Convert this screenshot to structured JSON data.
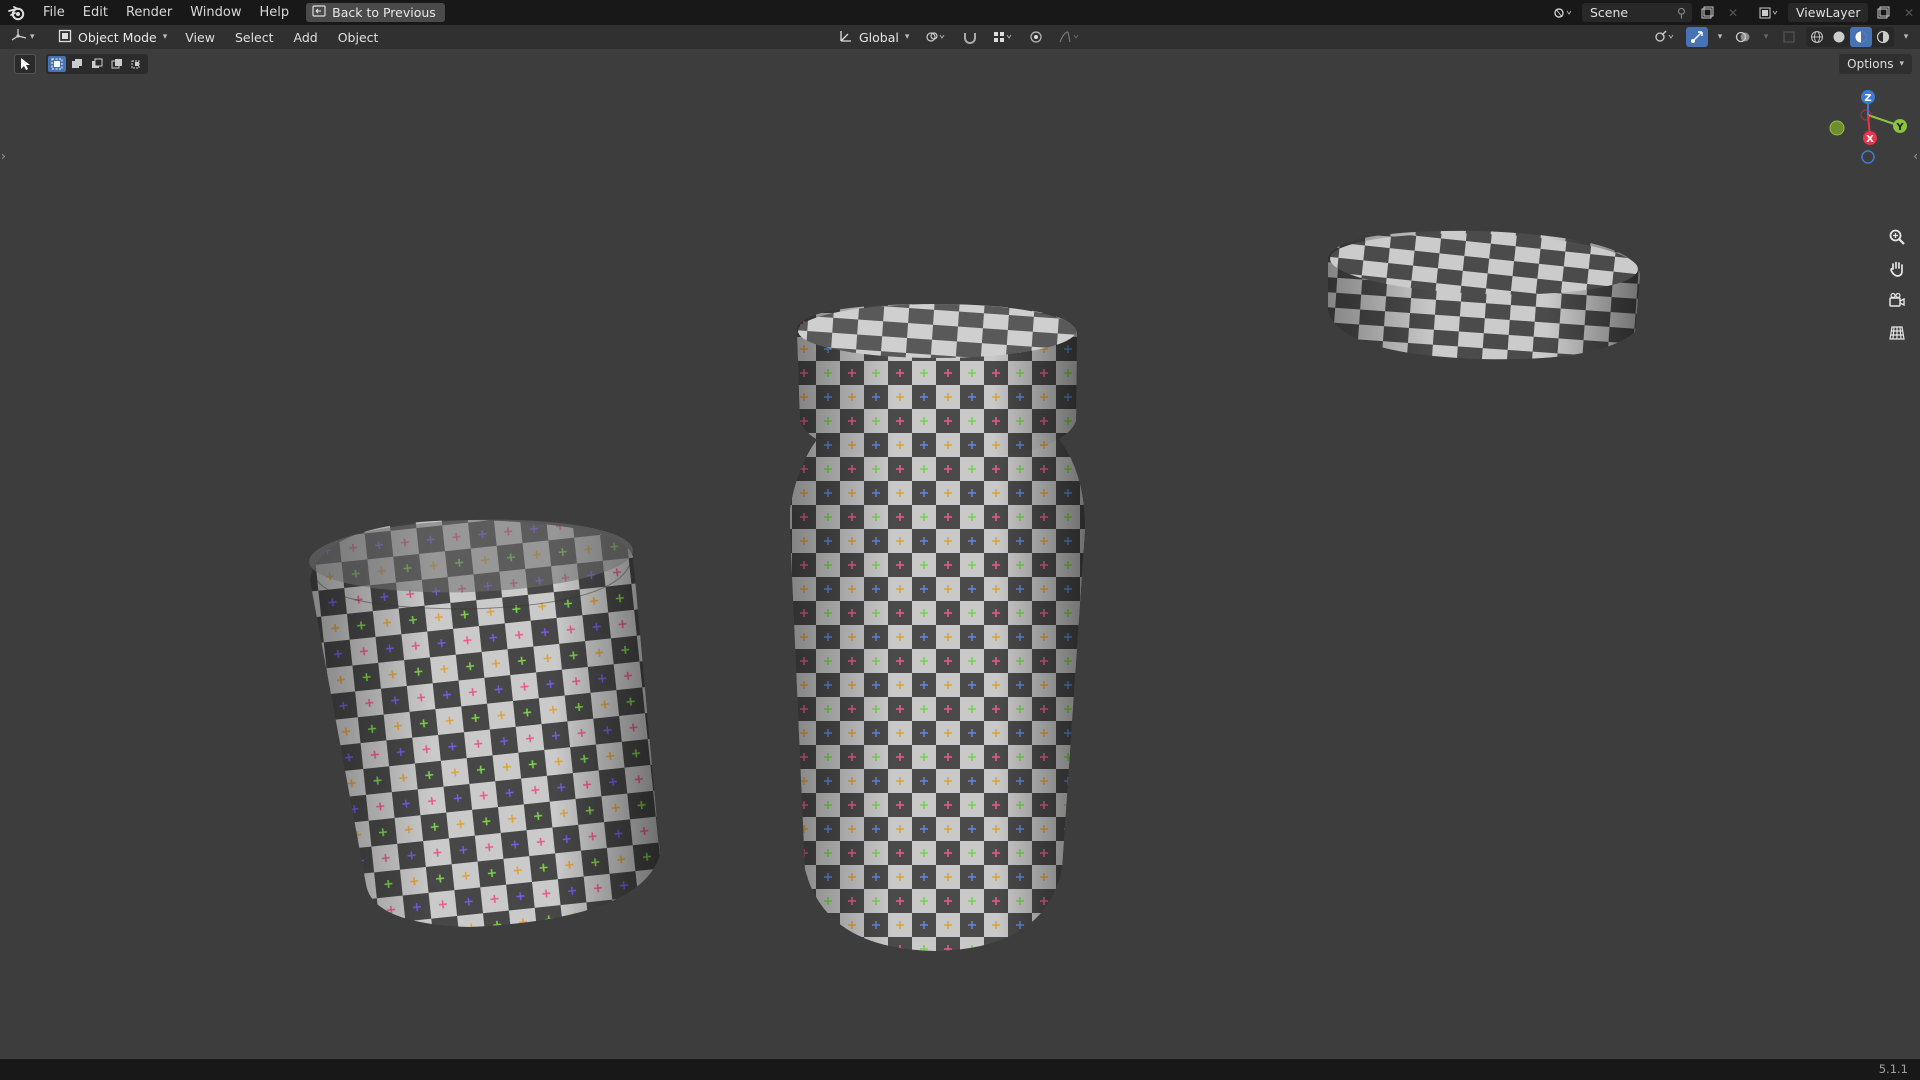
{
  "topbar": {
    "menus": [
      "File",
      "Edit",
      "Render",
      "Window",
      "Help"
    ],
    "back_button": "Back to Previous",
    "scene_name": "Scene",
    "view_layer_name": "ViewLayer"
  },
  "header": {
    "mode": "Object Mode",
    "menus": [
      "View",
      "Select",
      "Add",
      "Object"
    ],
    "orientation": "Global"
  },
  "toolbar": {
    "options_label": "Options"
  },
  "gizmo": {
    "axis_z": "Z",
    "axis_y": "Y",
    "axis_x": "X"
  },
  "status": {
    "version": "5.1.1"
  },
  "colors": {
    "topbar_bg": "#181818",
    "header_bg": "#303030",
    "viewport_bg": "#3d3d3d",
    "accent": "#4772b3",
    "axis_x": "#e8344c",
    "axis_y": "#8bc53f",
    "axis_z": "#3d7ad6"
  },
  "icons": {
    "app": "blender-logo-icon",
    "back": "back-to-previous-icon",
    "navigation": [
      "zoom-icon",
      "pan-hand-icon",
      "camera-icon",
      "grid-perspective-icon"
    ]
  }
}
